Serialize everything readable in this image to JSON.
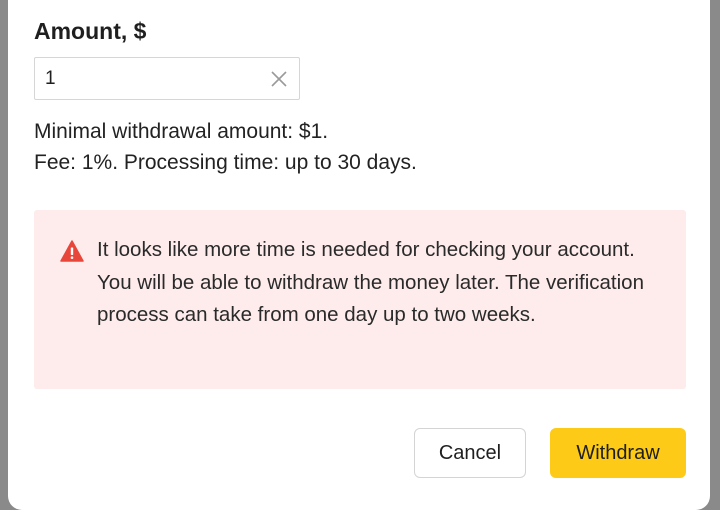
{
  "amount": {
    "label": "Amount, $",
    "value": "1",
    "clear_icon": "close-icon"
  },
  "info": {
    "line1": "Minimal withdrawal amount: $1.",
    "line2": "Fee: 1%. Processing time: up to 30 days."
  },
  "alert": {
    "icon": "warning-icon",
    "icon_color": "#e9463b",
    "background": "#fdeceb",
    "message": "It looks like more time is needed for checking your account. You will be able to withdraw the money later. The verification process can take from one day up to two weeks."
  },
  "actions": {
    "cancel_label": "Cancel",
    "withdraw_label": "Withdraw",
    "withdraw_color": "#fdcb17"
  }
}
